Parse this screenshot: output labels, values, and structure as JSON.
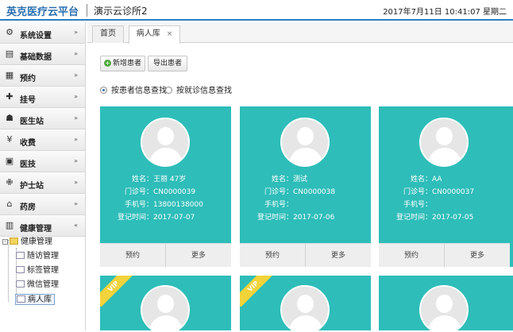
{
  "header": {
    "brand": "英克医疗云平台",
    "clinic": "演示云诊所2",
    "datetime": "2017年7月11日 10:41:07 星期二"
  },
  "sidebar": {
    "items": [
      {
        "label": "系统设置",
        "icon": "gear-icon",
        "chevron": "»"
      },
      {
        "label": "基础数据",
        "icon": "list-icon",
        "chevron": "»"
      },
      {
        "label": "预约",
        "icon": "calendar-icon",
        "chevron": "»"
      },
      {
        "label": "挂号",
        "icon": "register-icon",
        "chevron": "»"
      },
      {
        "label": "医生站",
        "icon": "doctor-icon",
        "chevron": "»"
      },
      {
        "label": "收费",
        "icon": "money-icon",
        "chevron": "»"
      },
      {
        "label": "医技",
        "icon": "flask-icon",
        "chevron": "»"
      },
      {
        "label": "护士站",
        "icon": "nurse-icon",
        "chevron": "»"
      },
      {
        "label": "药房",
        "icon": "pharmacy-icon",
        "chevron": "»"
      },
      {
        "label": "健康管理",
        "icon": "health-icon",
        "chevron": "«"
      }
    ],
    "tree": {
      "root": "健康管理",
      "children": [
        "随访管理",
        "标签管理",
        "微信管理",
        "病人库"
      ],
      "selected": "病人库"
    }
  },
  "tabs": [
    {
      "label": "首页"
    },
    {
      "label": "病人库",
      "close": "×"
    }
  ],
  "toolbar": {
    "add_label": "新增患者",
    "export_label": "导出患者"
  },
  "search": {
    "option1": "按患者信息查找",
    "option2": "按就诊信息查找",
    "selected": "option1"
  },
  "field_labels": {
    "name": "姓名：",
    "outpatient": "门诊号：",
    "phone": "手机号：",
    "registered": "登记时间："
  },
  "patients": [
    {
      "name": "王丽 47岁",
      "outpatient_no": "CN0000039",
      "phone": "13800138000",
      "registered": "2017-07-07",
      "btn1": "预约",
      "btn2": "更多"
    },
    {
      "name": "测试",
      "outpatient_no": "CN0000038",
      "phone": "",
      "registered": "2017-07-06",
      "btn1": "预约",
      "btn2": "更多"
    },
    {
      "name": "AA",
      "outpatient_no": "CN0000037",
      "phone": "",
      "registered": "2017-07-05",
      "btn1": "预约",
      "btn2": "更多"
    }
  ],
  "vip_cards": [
    {
      "badge": "VIP"
    },
    {
      "badge": "VIP"
    },
    {
      "badge": ""
    }
  ],
  "colors": {
    "card": "#2ebdb9",
    "brand": "#2b6fb0",
    "vip": "#f2d33a"
  }
}
